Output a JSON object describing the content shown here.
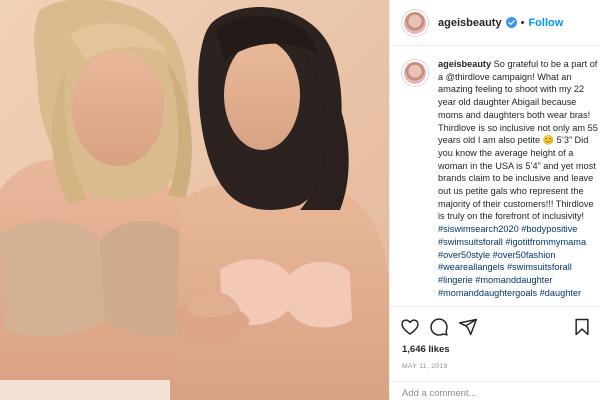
{
  "post": {
    "username": "ageisbeauty",
    "separator": "•",
    "follow_label": "Follow",
    "caption": {
      "username": "ageisbeauty",
      "text": "So grateful to be a part of a @thirdlove campaign! What an amazing feeling to shoot with my 22 year old daughter Abigail because moms and daughters both wear bras! Thirdlove is so inclusive not only am 55 years old I am also petite 😊 5’3” Did you know the average height of a woman in the USA is 5’4” and yet most brands claim to be inclusive and leave out us petite gals who represent the majority of their customers!!! Thirdlove is truly on the forefront of inclusivity!",
      "hashtags": "#siswimsearch2020 #bodypositive #swimsuitsforall #igotitfrommymama #over50style #over50fashion #weareallangels #swimsuitsforall #lingerie #momanddaughter #momanddaughtergoals #daughter"
    },
    "likes": "1,646 likes",
    "date": "MAY 11, 2019",
    "comment_placeholder": "Add a comment..."
  },
  "icons": {
    "like": "heart-icon",
    "comment": "comment-icon",
    "share": "share-icon",
    "save": "bookmark-icon",
    "verified": "verified-badge-icon"
  },
  "colors": {
    "link": "#0095f6",
    "hashtag": "#00376b",
    "muted": "#8e8e8e",
    "photo_background": "#e9c7ab"
  }
}
